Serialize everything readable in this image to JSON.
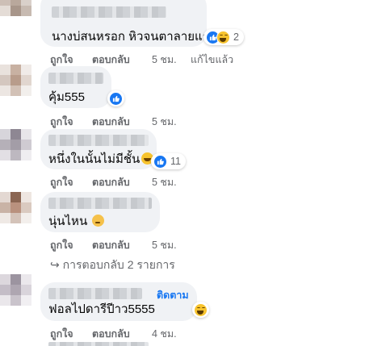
{
  "comments": [
    {
      "text": "นางบ่สนหรอก หิวจนตาลายแระ",
      "reactions": {
        "types": [
          "like-icon",
          "haha-icon"
        ],
        "count": "2"
      },
      "actions": {
        "like": "ถูกใจ",
        "reply": "ตอบกลับ",
        "time": "5 ชม.",
        "edited": "แก้ไขแล้ว"
      }
    },
    {
      "text": "คุ้ม555",
      "reactions": {
        "types": [
          "like-icon"
        ],
        "count": ""
      },
      "actions": {
        "like": "ถูกใจ",
        "reply": "ตอบกลับ",
        "time": "5 ชม."
      }
    },
    {
      "text": "หนึ่งในนั้นไม่มีชั้น",
      "text_emoji": "grinning-face-icon",
      "reactions": {
        "types": [
          "like-icon"
        ],
        "count": "11"
      },
      "actions": {
        "like": "ถูกใจ",
        "reply": "ตอบกลับ",
        "time": "5 ชม."
      }
    },
    {
      "text": "นุ่นไหน",
      "text_emoji": "thinking-face-icon",
      "actions": {
        "like": "ถูกใจ",
        "reply": "ตอบกลับ",
        "time": "5 ชม."
      },
      "replies_link": "↪ การตอบกลับ 2 รายการ"
    },
    {
      "follow_label": "ติดตาม",
      "text": "ฟอลไปดารีปีาว5555",
      "reactions": {
        "types": [
          "haha-icon"
        ],
        "count": ""
      },
      "actions": {
        "like": "ถูกใจ",
        "reply": "ตอบกลับ",
        "time": "4 ชม."
      }
    }
  ],
  "colors": {
    "bubble": "#f0f2f5",
    "like_blue": "#1877f2",
    "meta_gray": "#65676b",
    "haha_yellow": "#f7c32e"
  }
}
